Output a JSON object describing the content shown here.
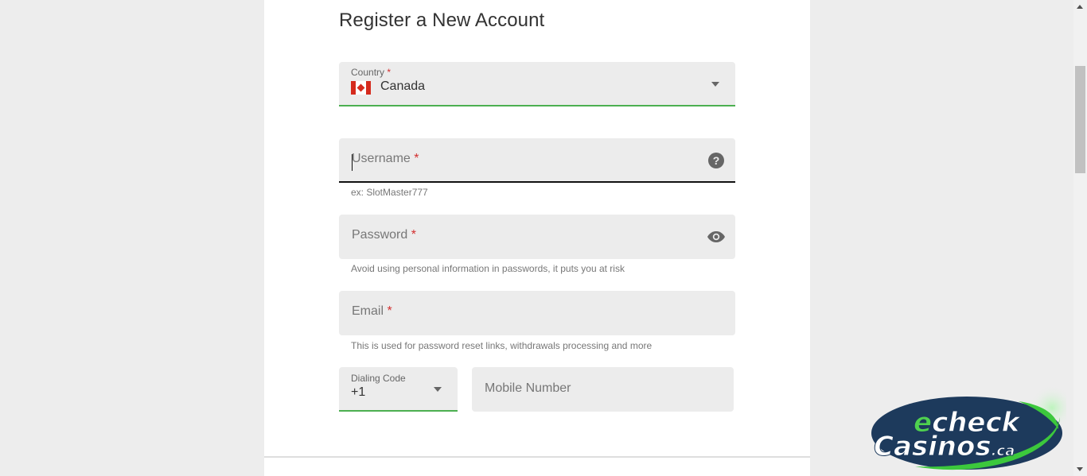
{
  "page": {
    "title": "Register a New Account"
  },
  "form": {
    "country": {
      "label": "Country",
      "required_mark": "*",
      "value": "Canada",
      "flag_icon": "canada-flag-icon"
    },
    "username": {
      "placeholder": "Username",
      "required_mark": "*",
      "value": "",
      "help_icon": "question-circle-icon",
      "help_icon_glyph": "?",
      "helper": "ex: SlotMaster777"
    },
    "password": {
      "placeholder": "Password",
      "required_mark": "*",
      "value": "",
      "visibility_icon": "eye-icon",
      "helper": "Avoid using personal information in passwords, it puts you at risk"
    },
    "email": {
      "placeholder": "Email",
      "required_mark": "*",
      "value": "",
      "helper": "This is used for password reset links, withdrawals processing and more"
    },
    "dialing_code": {
      "label": "Dialing Code",
      "value": "+1"
    },
    "mobile": {
      "placeholder": "Mobile Number",
      "value": ""
    }
  },
  "logo": {
    "line1": "echeck",
    "line2": "Casinos",
    "suffix": ".ca"
  },
  "colors": {
    "accent_green": "#4caf50",
    "required_red": "#d32f2f",
    "field_bg": "#ececec",
    "page_bg": "#ededed"
  }
}
